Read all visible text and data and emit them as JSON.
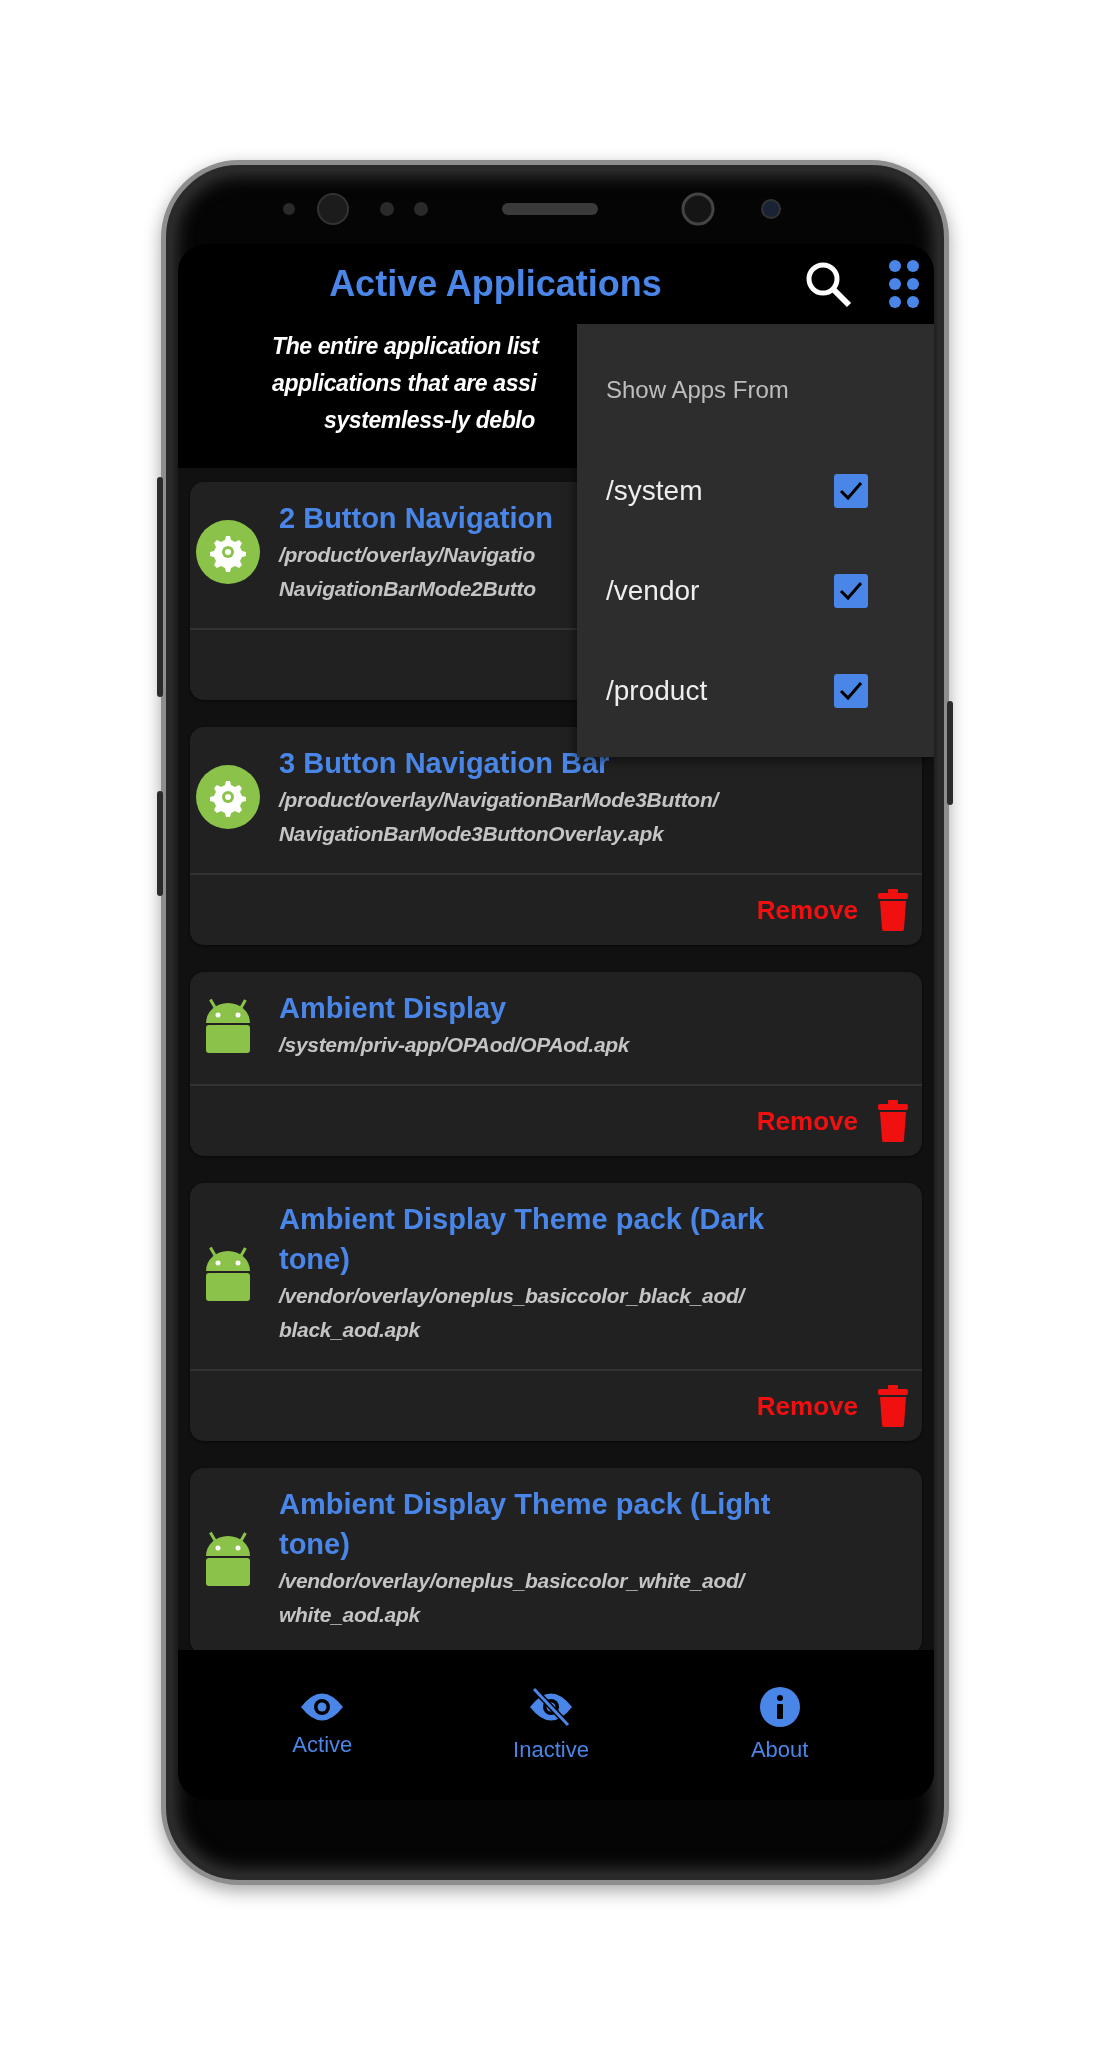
{
  "header": {
    "title": "Active Applications",
    "description_lines": [
      "The entire application list",
      "applications that are assi",
      "systemless-ly deblo"
    ]
  },
  "menu": {
    "title": "Show Apps From",
    "options": [
      {
        "label": "/system",
        "checked": true
      },
      {
        "label": "/vendor",
        "checked": true
      },
      {
        "label": "/product",
        "checked": true
      }
    ]
  },
  "apps": [
    {
      "kind": "overlay",
      "name_lines": [
        "2 Button Navigation"
      ],
      "path_lines": [
        "/product/overlay/Navigatio",
        "NavigationBarMode2Butto"
      ],
      "footer": true
    },
    {
      "kind": "overlay",
      "name_lines": [
        "3 Button Navigation Bar"
      ],
      "path_lines": [
        "/product/overlay/NavigationBarMode3Button/",
        "NavigationBarMode3ButtonOverlay.apk"
      ],
      "footer": true,
      "remove_label": "Remove"
    },
    {
      "kind": "app",
      "name_lines": [
        "Ambient Display"
      ],
      "path_lines": [
        "/system/priv-app/OPAod/OPAod.apk"
      ],
      "footer": true,
      "remove_label": "Remove"
    },
    {
      "kind": "app",
      "name_lines": [
        "Ambient Display Theme pack (Dark",
        "tone)"
      ],
      "path_lines": [
        "/vendor/overlay/oneplus_basiccolor_black_aod/",
        "black_aod.apk"
      ],
      "footer": true,
      "remove_label": "Remove"
    },
    {
      "kind": "app",
      "name_lines": [
        "Ambient Display Theme pack (Light",
        "tone)"
      ],
      "path_lines": [
        "/vendor/overlay/oneplus_basiccolor_white_aod/",
        "white_aod.apk"
      ],
      "footer": false
    }
  ],
  "nav": [
    {
      "kind": "active",
      "label": "Active"
    },
    {
      "kind": "inactive",
      "label": "Inactive"
    },
    {
      "kind": "about",
      "label": "About"
    }
  ]
}
